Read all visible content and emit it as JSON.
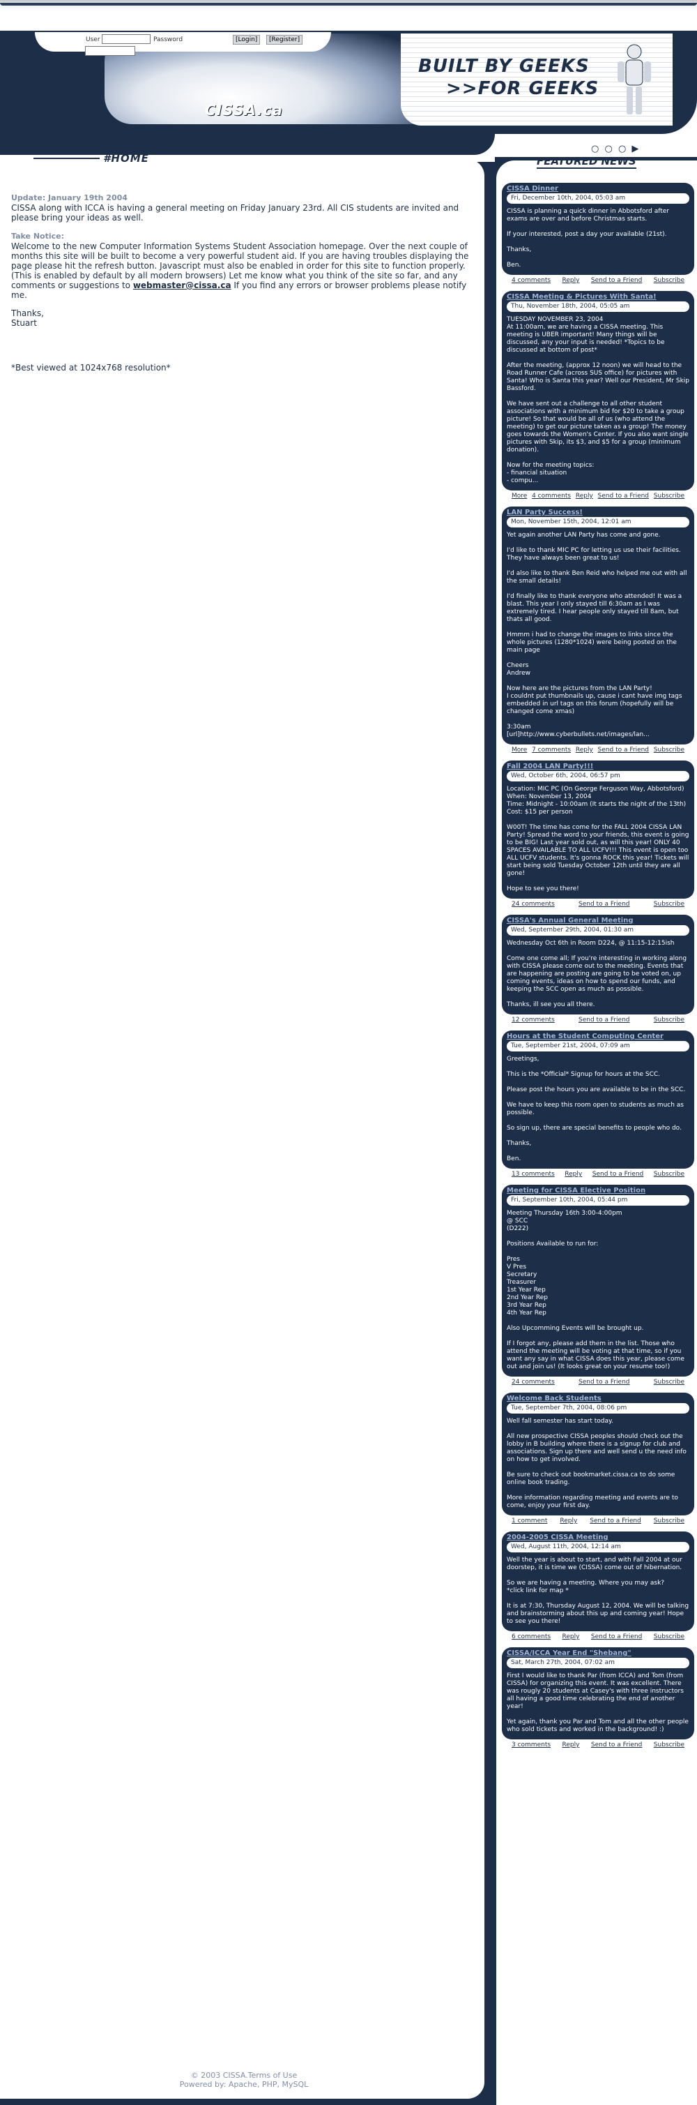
{
  "login": {
    "user_label": "User",
    "password_label": "Password",
    "login_btn": "[Login]",
    "register_btn": "[Register]"
  },
  "header": {
    "logo": "CISSA.ca",
    "slogan_line1": "BUILT BY GEEKS",
    "slogan_line2": ">>FOR GEEKS"
  },
  "nav": {
    "home": "#HOME",
    "dots": "○ ○ ○ ▶",
    "featured": "FEATURED NEWS"
  },
  "main": {
    "update_label": "Update: January 19th 2004",
    "update_text": "CISSA along with ICCA is having a general meeting on Friday January 23rd. All CIS students are invited and please bring your ideas as well.",
    "notice_label": "Take Notice:",
    "notice_text_1": "Welcome to the new Computer Information Systems Student Association homepage.  Over the next couple of months this site will be built to become a very powerful student aid. If you are having troubles displaying the page please hit the refresh button. Javascript must also be enabled in order for this site to function properly. (This is enabled by default by all modern browsers) Let me know what you think of the site so far, and any comments or suggestions to ",
    "notice_email": "webmaster@cissa.ca",
    "notice_text_2": " If you find any errors or browser problems please notify me.",
    "thanks": "Thanks,",
    "signoff": "Stuart",
    "best_viewed": "*Best viewed at 1024x768 resolution*"
  },
  "footer": {
    "line1": "© 2003 CISSA.Terms of Use",
    "line2": "Powered by: Apache, PHP, MySQL"
  },
  "news": [
    {
      "title": "CISSA Dinner",
      "date": "Fri, December 10th, 2004, 05:03 am",
      "body": "CISSA is planning a quick dinner in Abbotsford after exams are over and before Christmas starts.\n\nIf your interested, post a day your available (21st).\n\nThanks,\n\nBen.",
      "links": [
        "4 comments",
        "Reply",
        "Send to a Friend",
        "Subscribe"
      ]
    },
    {
      "title": "CISSA Meeting & Pictures With Santa!",
      "date": "Thu, November 18th, 2004, 05:05 am",
      "body": "TUESDAY NOVEMBER 23, 2004\nAt 11:00am, we are having a CISSA meeting. This meeting is UBER important! Many things will be discussed, any your input is needed! *Topics to be discussed at bottom of post*\n\nAfter the meeting, (approx 12 noon) we will head to the Road Runner Cafe (across SUS office) for pictures with Santa! Who is Santa this year? Well our President, Mr Skip Bassford.\n\nWe have sent out a challenge to all other student associations with a minimum bid for $20 to take a group picture! So that would be all of us (who attend the meeting) to get our picture taken as a group! The money goes towards the Women's Center. If you also want single pictures with Skip, its $3, and $5 for a group (minimum donation).\n\nNow for the meeting topics:\n- financial situation\n- compu...",
      "links": [
        "More",
        "4 comments",
        "Reply",
        "Send to a Friend",
        "Subscribe"
      ]
    },
    {
      "title": "LAN Party Success!",
      "date": "Mon, November 15th, 2004, 12:01 am",
      "body": "Yet again another LAN Party has come and gone.\n\nI'd like to thank MIC PC for letting us use their facilities. They have always been great to us!\n\nI'd also like to thank Ben Reid who helped me out with all the small details!\n\nI'd finally like to thank everyone who attended! It was a blast. This year I only stayed till 6:30am as I was extremely tired. I hear people only stayed till 8am, but thats all good.\n\nHmmm i had to change the images to links since the whole pictures (1280*1024) were being posted on the main page\n\nCheers\nAndrew\n\nNow here are the pictures from the LAN Party!\nI couldnt put thumbnails up, cause i cant have img tags embedded in url tags on this forum (hopefully will be changed come xmas)\n\n3:30am\n[url]http://www.cyberbullets.net/images/lan...",
      "links": [
        "More",
        "7 comments",
        "Reply",
        "Send to a Friend",
        "Subscribe"
      ]
    },
    {
      "title": "Fall 2004 LAN Party!!!",
      "date": "Wed, October 6th, 2004, 06:57 pm",
      "body": "Location: MIC PC (On George Ferguson Way, Abbotsford)\nWhen: November 13, 2004\nTime: Midnight - 10:00am (It starts the night of the 13th)\nCost: $15 per person\n\nW00T! The time has come for the FALL 2004 CISSA LAN Party! Spread the word to your friends, this event is going to be BIG! Last year sold out, as will this year! ONLY 40 SPACES AVAILABLE TO ALL UCFV!!! This event is open too ALL UCFV students. It's gonna ROCK this year! Tickets will start being sold Tuesday October 12th until they are all gone!\n\nHope to see you there!",
      "links": [
        "24 comments",
        "Send to a Friend",
        "Subscribe"
      ]
    },
    {
      "title": "CISSA's Annual General Meeting",
      "date": "Wed, September 29th, 2004, 01:30 am",
      "body": "Wednesday Oct 6th in Room D224, @ 11:15-12:15ish\n\nCome one come all; If you're interesting in working along with CISSA please come out to the meeting. Events that are happening are posting are going to be voted on, up coming events, ideas on how to spend our funds, and keeping the SCC open as much as possible.\n\nThanks, ill see you all there.",
      "links": [
        "12 comments",
        "Send to a Friend",
        "Subscribe"
      ]
    },
    {
      "title": "Hours at the Student Computing Center",
      "date": "Tue, September 21st, 2004, 07:09 am",
      "body": "Greetings,\n\nThis is the *Official* Signup for hours at the SCC.\n\nPlease post the hours you are available to be in the SCC.\n\nWe have to keep this room open to students as much as possible.\n\nSo sign up, there are special benefits to people who do.\n\nThanks,\n\nBen.",
      "links": [
        "13 comments",
        "Reply",
        "Send to a Friend",
        "Subscribe"
      ]
    },
    {
      "title": "Meeting for CISSA Elective Position",
      "date": "Fri, September 10th, 2004, 05:44 pm",
      "body": "Meeting Thursday 16th 3:00-4:00pm\n@ SCC\n(D222)\n\nPositions Available to run for:\n\nPres\nV Pres\nSecretary\nTreasurer\n1st Year Rep\n2nd Year Rep\n3rd Year Rep\n4th Year Rep\n\nAlso Upcomming Events will be brought up.\n\nIf I forgot any, please add them in the list. Those who attend the meeting will be voting at that time, so if you want any say in what CISSA does this year, please come out and join us! (It looks great on your resume too!)",
      "links": [
        "24 comments",
        "Send to a Friend",
        "Subscribe"
      ]
    },
    {
      "title": "Welcome Back Students",
      "date": "Tue, September 7th, 2004, 08:06 pm",
      "body": "Well fall semester has start today.\n\nAll new prospective CISSA peoples should check out the lobby in B building where there is a signup for club and associations. Sign up there and well send u the need info on how to get involved.\n\nBe sure to check out bookmarket.cissa.ca to do some online book trading.\n\nMore information regarding meeting and events are to come, enjoy your first day.",
      "links": [
        "1 comment",
        "Reply",
        "Send to a Friend",
        "Subscribe"
      ]
    },
    {
      "title": "2004-2005 CISSA Meeting",
      "date": "Wed, August 11th, 2004, 12:14 am",
      "body": "Well the year is about to start, and with Fall 2004 at our doorstep, it is time we (CISSA) come out of hibernation.\n\nSo we are having a meeting. Where you may ask?\n*click link for map *\n\nIt is at 7:30, Thursday August 12, 2004. We will be talking and brainstorming about this up and coming year! Hope to see you there!",
      "links": [
        "6 comments",
        "Reply",
        "Send to a Friend",
        "Subscribe"
      ]
    },
    {
      "title": "CISSA/ICCA Year End \"Shebang\"",
      "date": "Sat, March 27th, 2004, 07:02 am",
      "body": "First I would like to thank Par (from ICCA) and Tom (from CISSA) for organizing this event. It was excellent. There was rougly 20 students at Casey's with three instructors all having a good time celebrating the end of another year!\n\nYet again, thank you Par and Tom and all the other people who sold tickets and worked in the background! :)",
      "links": [
        "3 comments",
        "Reply",
        "Send to a Friend",
        "Subscribe"
      ]
    }
  ]
}
